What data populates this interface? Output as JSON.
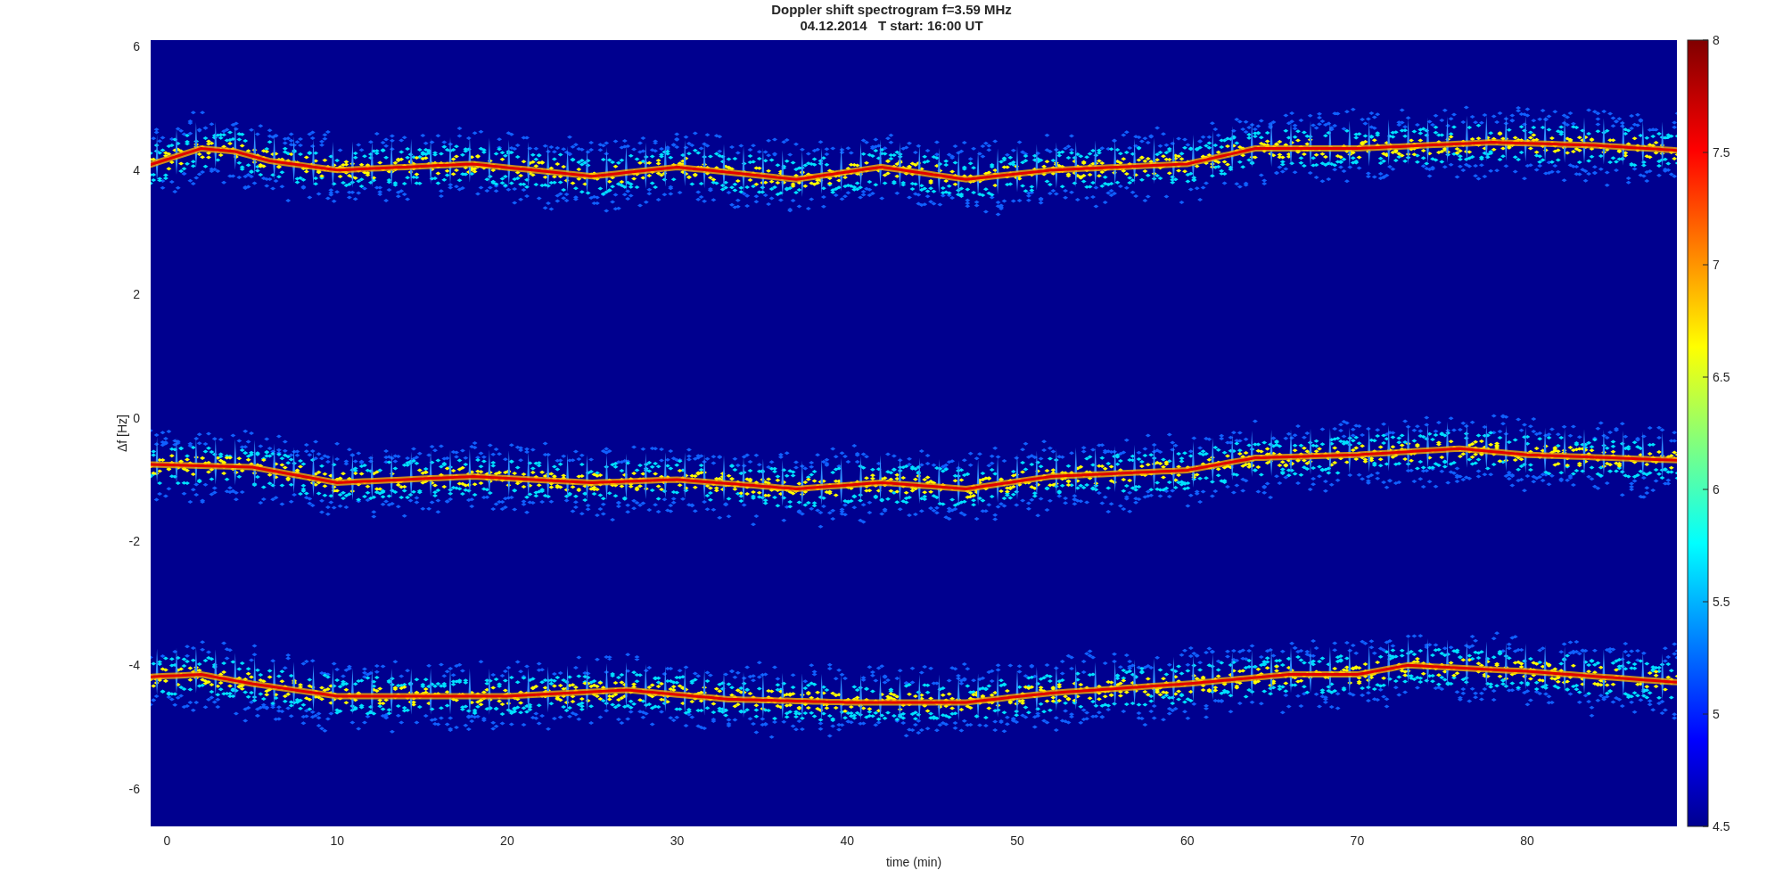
{
  "figure": {
    "title_lines": [
      "Doppler shift spectrogram f=3.59 MHz",
      "04.12.2014   T start: 16:00 UT"
    ],
    "xlabel": "time (min)",
    "ylabel": "Δf [Hz]",
    "xticks": [
      "0",
      "10",
      "20",
      "30",
      "40",
      "50",
      "60",
      "70",
      "80"
    ],
    "yticks": [
      "6",
      "4",
      "2",
      "0",
      "-2",
      "-4",
      "-6"
    ],
    "colorbar": {
      "ticks": [
        "8",
        "7.5",
        "7",
        "6.5",
        "6",
        "5.5",
        "5",
        "4.5"
      ]
    }
  }
}
